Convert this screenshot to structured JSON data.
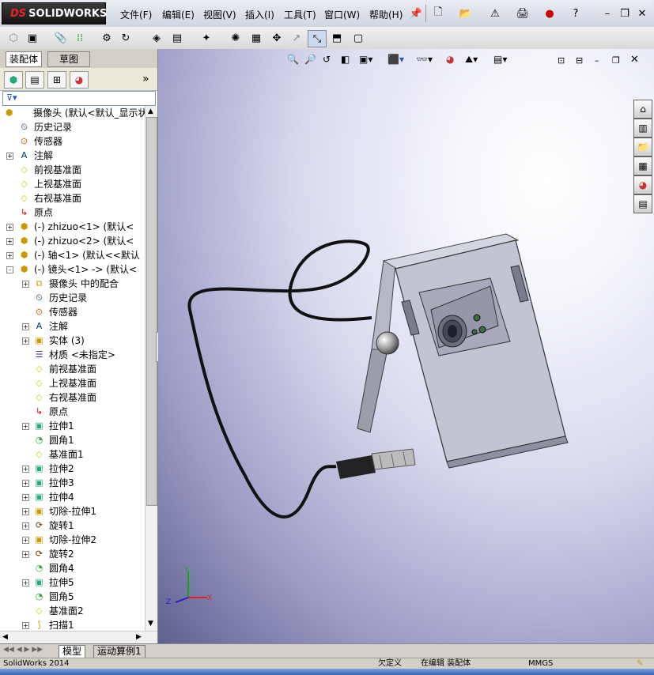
{
  "app": {
    "brand": "SOLIDWORKS",
    "brand_prefix": "DS"
  },
  "menu": [
    "文件(F)",
    "编辑(E)",
    "视图(V)",
    "插入(I)",
    "工具(T)",
    "窗口(W)",
    "帮助(H)"
  ],
  "panel_tabs": {
    "assembly": "装配体",
    "sketch": "草图"
  },
  "tree": [
    {
      "label": "摄像头  (默认<默认_显示状",
      "level": 0,
      "expander": ""
    },
    {
      "label": "历史记录",
      "level": 1,
      "expander": ""
    },
    {
      "label": "传感器",
      "level": 1,
      "expander": ""
    },
    {
      "label": "注解",
      "level": 1,
      "expander": "+"
    },
    {
      "label": "前视基准面",
      "level": 1,
      "expander": ""
    },
    {
      "label": "上视基准面",
      "level": 1,
      "expander": ""
    },
    {
      "label": "右视基准面",
      "level": 1,
      "expander": ""
    },
    {
      "label": "原点",
      "level": 1,
      "expander": ""
    },
    {
      "label": "(-) zhizuo<1> (默认<",
      "level": 1,
      "expander": "+"
    },
    {
      "label": "(-) zhizuo<2> (默认<",
      "level": 1,
      "expander": "+"
    },
    {
      "label": "(-) 轴<1> (默认<<默认",
      "level": 1,
      "expander": "+"
    },
    {
      "label": "(-) 镜头<1> -> (默认<",
      "level": 1,
      "expander": "-"
    },
    {
      "label": "摄像头 中的配合",
      "level": 2,
      "expander": "+"
    },
    {
      "label": "历史记录",
      "level": 2,
      "expander": ""
    },
    {
      "label": "传感器",
      "level": 2,
      "expander": ""
    },
    {
      "label": "注解",
      "level": 2,
      "expander": "+"
    },
    {
      "label": "实体 (3)",
      "level": 2,
      "expander": "+"
    },
    {
      "label": "材质 <未指定>",
      "level": 2,
      "expander": ""
    },
    {
      "label": "前视基准面",
      "level": 2,
      "expander": ""
    },
    {
      "label": "上视基准面",
      "level": 2,
      "expander": ""
    },
    {
      "label": "右视基准面",
      "level": 2,
      "expander": ""
    },
    {
      "label": "原点",
      "level": 2,
      "expander": ""
    },
    {
      "label": "拉伸1",
      "level": 2,
      "expander": "+"
    },
    {
      "label": "圆角1",
      "level": 2,
      "expander": ""
    },
    {
      "label": "基准面1",
      "level": 2,
      "expander": ""
    },
    {
      "label": "拉伸2",
      "level": 2,
      "expander": "+"
    },
    {
      "label": "拉伸3",
      "level": 2,
      "expander": "+"
    },
    {
      "label": "拉伸4",
      "level": 2,
      "expander": "+"
    },
    {
      "label": "切除-拉伸1",
      "level": 2,
      "expander": "+"
    },
    {
      "label": "旋转1",
      "level": 2,
      "expander": "+"
    },
    {
      "label": "切除-拉伸2",
      "level": 2,
      "expander": "+"
    },
    {
      "label": "旋转2",
      "level": 2,
      "expander": "+"
    },
    {
      "label": "圆角4",
      "level": 2,
      "expander": ""
    },
    {
      "label": "拉伸5",
      "level": 2,
      "expander": "+"
    },
    {
      "label": "圆角5",
      "level": 2,
      "expander": ""
    },
    {
      "label": "基准面2",
      "level": 2,
      "expander": ""
    },
    {
      "label": "扫描1",
      "level": 2,
      "expander": "+"
    }
  ],
  "bottom_tabs": {
    "model": "模型",
    "motion": "运动算例1"
  },
  "status": {
    "app_version": "SolidWorks 2014",
    "undefined": "欠定义",
    "editing": "在编辑 装配体",
    "units": "MMGS"
  },
  "triad": {
    "x": "X",
    "y": "Y",
    "z": "Z"
  }
}
